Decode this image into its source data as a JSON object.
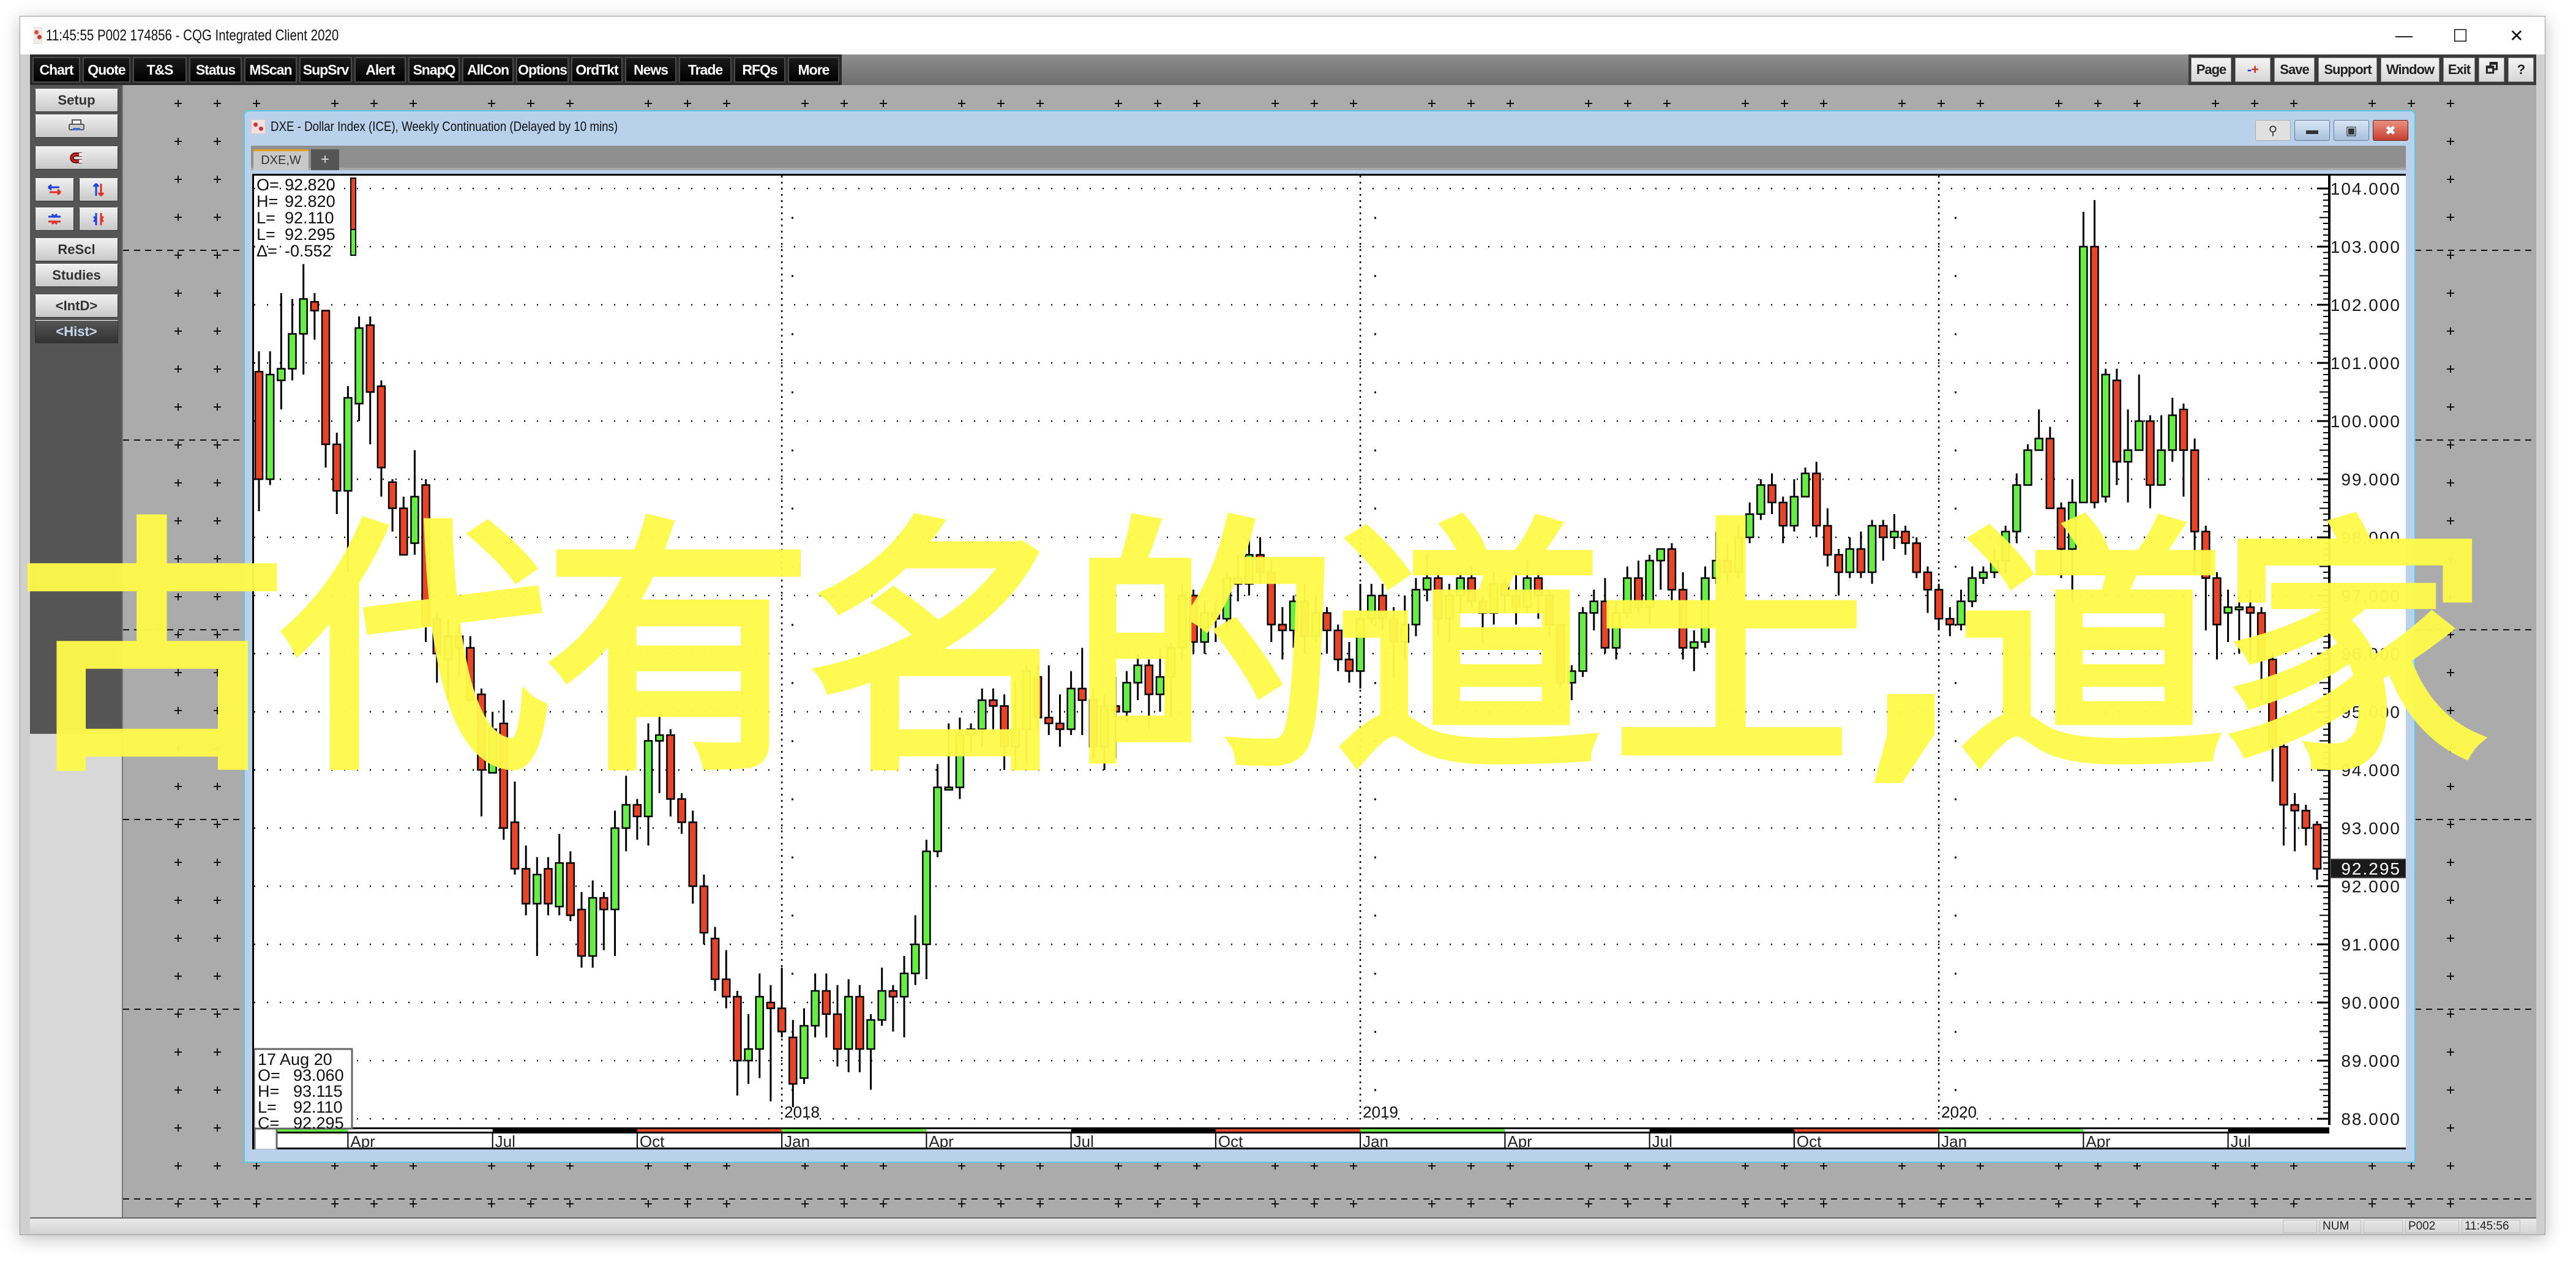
{
  "app": {
    "title": "11:45:55   P002   174856 - CQG Integrated Client 2020",
    "window_controls": {
      "minimize": "—",
      "maximize": "☐",
      "close": "✕"
    }
  },
  "toolbar": {
    "left_buttons": [
      "Chart",
      "Quote",
      "T&S",
      "Status",
      "MScan",
      "SupSrv",
      "Alert",
      "SnapQ",
      "AllCon",
      "Options",
      "OrdTkt",
      "News",
      "Trade",
      "RFQs",
      "More"
    ],
    "right_buttons": [
      "Page",
      "-+",
      "Save",
      "Support",
      "Window",
      "Exit",
      "🗗",
      "?"
    ]
  },
  "sidebar": {
    "setup": "Setup",
    "print_icon": "printer-icon",
    "magnet_icon": "magnet-icon",
    "rescl": "ReScl",
    "studies": "Studies",
    "intd": "<IntD>",
    "hist": "<Hist>"
  },
  "chart_window": {
    "title": "DXE - Dollar Index (ICE), Weekly Continuation (Delayed by 10 mins)",
    "tab_label": "DXE,W",
    "tab_add": "+",
    "controls": {
      "pin": "⚲",
      "minimize": "▬",
      "restore": "▣",
      "close": "✖"
    }
  },
  "top_readout": [
    {
      "label": "O=",
      "value": "92.820"
    },
    {
      "label": "H=",
      "value": "92.820"
    },
    {
      "label": "L=",
      "value": "92.110"
    },
    {
      "label": "L=",
      "value": "92.295"
    },
    {
      "label": "Δ=",
      "value": "-0.552"
    }
  ],
  "cursor_readout": {
    "date": "17 Aug 20",
    "rows": [
      {
        "label": "O=",
        "value": "93.060"
      },
      {
        "label": "H=",
        "value": "93.115"
      },
      {
        "label": "L=",
        "value": "92.110"
      },
      {
        "label": "C=",
        "value": "92.295"
      }
    ]
  },
  "last_price_tag": "92.295",
  "status_bar": {
    "num": "NUM",
    "page": "P002",
    "time": "11:45:56"
  },
  "overlay_text": "古代有名的道士,道家",
  "colors": {
    "up": "#66ee44",
    "down": "#e84428",
    "overlay": "#fefa4a",
    "toolbar": "#000000"
  },
  "chart_data": {
    "type": "candlestick",
    "title": "DXE - Dollar Index (ICE), Weekly Continuation",
    "xlabel": "",
    "ylabel": "",
    "ylim": [
      87.6,
      104.3
    ],
    "y_ticks": [
      "104.000",
      "103.000",
      "102.000",
      "101.000",
      "100.000",
      "99.000",
      "98.000",
      "97.000",
      "96.000",
      "95.000",
      "94.000",
      "93.000",
      "92.000",
      "91.000",
      "90.000",
      "89.000",
      "88.000"
    ],
    "x_ticks": [
      {
        "label": "Apr",
        "week": 8
      },
      {
        "label": "Jul",
        "week": 21
      },
      {
        "label": "Oct",
        "week": 34
      },
      {
        "label": "Jan",
        "week": 47,
        "year": "2018"
      },
      {
        "label": "Apr",
        "week": 60
      },
      {
        "label": "Jul",
        "week": 73
      },
      {
        "label": "Oct",
        "week": 86
      },
      {
        "label": "Jan",
        "week": 99,
        "year": "2019"
      },
      {
        "label": "Apr",
        "week": 112
      },
      {
        "label": "Jul",
        "week": 125
      },
      {
        "label": "Oct",
        "week": 138
      },
      {
        "label": "Jan",
        "week": 151,
        "year": "2020"
      },
      {
        "label": "Apr",
        "week": 164
      },
      {
        "label": "Jul",
        "week": 177
      }
    ],
    "grid": true,
    "candles": [
      [
        100.85,
        99.0,
        101.2,
        98.45
      ],
      [
        99.0,
        100.8,
        101.2,
        98.9
      ],
      [
        100.7,
        100.9,
        102.2,
        100.2
      ],
      [
        100.9,
        101.5,
        102.1,
        100.7
      ],
      [
        101.5,
        102.1,
        102.7,
        100.8
      ],
      [
        102.05,
        101.9,
        102.2,
        101.4
      ],
      [
        101.9,
        99.6,
        101.6,
        99.2
      ],
      [
        99.6,
        98.8,
        99.8,
        98.4
      ],
      [
        98.8,
        100.4,
        100.6,
        97.4
      ],
      [
        100.3,
        101.6,
        101.8,
        100.0
      ],
      [
        101.65,
        100.5,
        101.8,
        99.6
      ],
      [
        100.6,
        99.2,
        100.7,
        98.7
      ],
      [
        98.95,
        98.5,
        99.0,
        98.1
      ],
      [
        98.5,
        97.7,
        98.7,
        97.7
      ],
      [
        97.9,
        98.7,
        99.5,
        97.7
      ],
      [
        98.9,
        96.5,
        99.0,
        96.2
      ],
      [
        96.6,
        96.0,
        96.7,
        95.5
      ],
      [
        95.9,
        96.3,
        96.6,
        95.2
      ],
      [
        96.3,
        96.1,
        96.5,
        95.6
      ],
      [
        96.1,
        95.2,
        96.3,
        95.2
      ],
      [
        95.3,
        94.0,
        95.4,
        93.2
      ],
      [
        93.95,
        94.7,
        95.0,
        94.0
      ],
      [
        94.8,
        93.0,
        95.2,
        92.8
      ],
      [
        93.1,
        92.3,
        93.8,
        92.2
      ],
      [
        92.3,
        91.7,
        92.7,
        91.5
      ],
      [
        91.7,
        92.2,
        92.5,
        90.8
      ],
      [
        92.3,
        91.7,
        92.5,
        91.5
      ],
      [
        91.65,
        92.4,
        92.9,
        91.5
      ],
      [
        92.4,
        91.5,
        92.6,
        91.4
      ],
      [
        91.6,
        90.8,
        91.9,
        90.6
      ],
      [
        90.8,
        91.8,
        92.1,
        90.6
      ],
      [
        91.8,
        91.6,
        91.9,
        90.9
      ],
      [
        91.6,
        93.0,
        93.3,
        90.8
      ],
      [
        93.0,
        93.4,
        93.9,
        92.6
      ],
      [
        93.4,
        93.2,
        93.5,
        92.8
      ],
      [
        93.2,
        94.5,
        94.8,
        92.7
      ],
      [
        94.5,
        94.6,
        95.0,
        93.6
      ],
      [
        94.6,
        93.5,
        94.7,
        93.2
      ],
      [
        93.5,
        93.1,
        93.6,
        92.9
      ],
      [
        93.1,
        92.0,
        93.3,
        91.7
      ],
      [
        92.0,
        91.2,
        92.2,
        91.0
      ],
      [
        91.1,
        90.4,
        91.3,
        90.2
      ],
      [
        90.4,
        90.1,
        90.9,
        89.9
      ],
      [
        90.1,
        89.0,
        90.2,
        88.4
      ],
      [
        89.0,
        89.2,
        89.8,
        88.6
      ],
      [
        89.2,
        90.1,
        90.5,
        88.7
      ],
      [
        90.0,
        89.9,
        90.3,
        88.3
      ],
      [
        89.9,
        89.5,
        90.6,
        89.4
      ],
      [
        89.4,
        88.6,
        89.7,
        88.2
      ],
      [
        88.7,
        89.6,
        89.9,
        88.6
      ],
      [
        89.6,
        90.2,
        90.5,
        89.4
      ],
      [
        90.2,
        89.8,
        90.5,
        89.4
      ],
      [
        89.8,
        89.2,
        90.3,
        88.9
      ],
      [
        89.2,
        90.1,
        90.4,
        88.8
      ],
      [
        90.1,
        89.2,
        90.3,
        88.8
      ],
      [
        89.2,
        89.7,
        89.8,
        88.5
      ],
      [
        89.7,
        90.2,
        90.6,
        89.6
      ],
      [
        90.2,
        90.1,
        90.3,
        89.5
      ],
      [
        90.1,
        90.5,
        90.8,
        89.4
      ],
      [
        90.5,
        91.0,
        91.5,
        90.3
      ],
      [
        91.0,
        92.6,
        92.8,
        90.4
      ],
      [
        92.6,
        93.7,
        94.1,
        92.5
      ],
      [
        93.7,
        93.7,
        94.8,
        93.7
      ],
      [
        93.7,
        94.6,
        94.9,
        93.5
      ],
      [
        94.6,
        94.7,
        94.8,
        94.3
      ],
      [
        94.7,
        95.2,
        95.4,
        94.4
      ],
      [
        95.2,
        95.1,
        95.4,
        94.7
      ],
      [
        95.1,
        94.4,
        95.3,
        94.0
      ],
      [
        94.4,
        94.7,
        95.5,
        94.0
      ],
      [
        94.7,
        95.7,
        95.8,
        94.1
      ],
      [
        95.6,
        94.9,
        95.8,
        94.7
      ],
      [
        94.9,
        94.8,
        95.8,
        94.6
      ],
      [
        94.8,
        94.7,
        95.3,
        94.4
      ],
      [
        94.7,
        95.4,
        95.7,
        94.6
      ],
      [
        95.4,
        95.2,
        96.1,
        94.6
      ],
      [
        95.2,
        94.4,
        95.4,
        94.2
      ],
      [
        94.4,
        95.1,
        95.3,
        94.0
      ],
      [
        95.1,
        95.0,
        95.6,
        94.2
      ],
      [
        95.0,
        95.5,
        95.7,
        94.8
      ],
      [
        95.5,
        95.8,
        96.0,
        95.2
      ],
      [
        95.8,
        95.3,
        95.9,
        94.7
      ],
      [
        95.3,
        95.6,
        96.1,
        95.0
      ],
      [
        95.6,
        96.1,
        96.2,
        94.9
      ],
      [
        96.1,
        97.0,
        97.2,
        95.9
      ],
      [
        97.0,
        96.2,
        97.1,
        96.0
      ],
      [
        96.2,
        96.7,
        96.9,
        96.0
      ],
      [
        96.7,
        96.6,
        96.9,
        96.2
      ],
      [
        96.6,
        97.3,
        97.4,
        96.4
      ],
      [
        97.3,
        97.2,
        97.7,
        96.9
      ],
      [
        97.2,
        97.7,
        98.0,
        97.0
      ],
      [
        97.7,
        97.4,
        98.0,
        97.2
      ],
      [
        97.4,
        96.5,
        97.6,
        96.2
      ],
      [
        96.5,
        96.4,
        96.8,
        95.9
      ],
      [
        96.4,
        96.9,
        97.0,
        96.1
      ],
      [
        96.9,
        96.3,
        97.2,
        96.0
      ],
      [
        96.3,
        96.7,
        97.0,
        96.2
      ],
      [
        96.7,
        96.4,
        96.8,
        96.0
      ],
      [
        96.4,
        95.9,
        96.5,
        95.7
      ],
      [
        95.9,
        95.7,
        96.2,
        95.5
      ],
      [
        95.7,
        96.6,
        97.2,
        95.4
      ],
      [
        96.6,
        97.0,
        97.2,
        96.5
      ],
      [
        97.0,
        96.6,
        97.2,
        96.4
      ],
      [
        96.6,
        96.2,
        96.8,
        95.6
      ],
      [
        96.2,
        96.5,
        97.0,
        95.9
      ],
      [
        96.5,
        97.1,
        97.3,
        96.3
      ],
      [
        97.1,
        97.3,
        97.7,
        96.9
      ],
      [
        97.3,
        96.6,
        97.4,
        96.3
      ],
      [
        96.6,
        97.0,
        97.2,
        96.2
      ],
      [
        97.0,
        97.3,
        97.4,
        96.7
      ],
      [
        97.3,
        96.9,
        97.5,
        96.8
      ],
      [
        96.9,
        96.7,
        97.0,
        96.2
      ],
      [
        96.7,
        97.2,
        97.4,
        96.5
      ],
      [
        97.2,
        97.0,
        97.3,
        96.7
      ],
      [
        97.0,
        96.8,
        97.4,
        96.5
      ],
      [
        96.8,
        97.3,
        97.6,
        96.7
      ],
      [
        97.3,
        97.0,
        97.4,
        96.6
      ],
      [
        97.0,
        96.5,
        97.1,
        96.3
      ],
      [
        96.5,
        95.5,
        96.5,
        95.4
      ],
      [
        95.5,
        95.7,
        95.8,
        95.2
      ],
      [
        95.7,
        96.7,
        96.8,
        95.6
      ],
      [
        96.7,
        96.9,
        97.1,
        96.4
      ],
      [
        96.9,
        96.1,
        97.3,
        96.0
      ],
      [
        96.1,
        96.7,
        96.9,
        95.9
      ],
      [
        96.7,
        97.3,
        97.5,
        96.6
      ],
      [
        97.3,
        96.8,
        97.6,
        96.7
      ],
      [
        96.8,
        97.6,
        97.7,
        96.5
      ],
      [
        97.6,
        97.8,
        97.8,
        97.1
      ],
      [
        97.8,
        97.1,
        97.9,
        96.9
      ],
      [
        97.1,
        96.1,
        97.4,
        95.9
      ],
      [
        96.1,
        96.2,
        96.4,
        95.7
      ],
      [
        96.2,
        97.3,
        97.5,
        96.1
      ],
      [
        97.3,
        97.6,
        98.1,
        97.2
      ],
      [
        97.6,
        97.4,
        97.9,
        97.2
      ],
      [
        97.4,
        98.0,
        98.2,
        97.3
      ],
      [
        98.0,
        98.4,
        98.6,
        97.9
      ],
      [
        98.4,
        98.9,
        99.0,
        98.3
      ],
      [
        98.9,
        98.6,
        99.1,
        98.4
      ],
      [
        98.6,
        98.2,
        98.7,
        97.9
      ],
      [
        98.2,
        98.7,
        99.0,
        98.1
      ],
      [
        98.7,
        99.1,
        99.2,
        98.7
      ],
      [
        99.1,
        98.2,
        99.3,
        98.0
      ],
      [
        98.2,
        97.7,
        98.5,
        97.5
      ],
      [
        97.7,
        97.4,
        97.8,
        97.0
      ],
      [
        97.4,
        97.8,
        98.0,
        97.3
      ],
      [
        97.8,
        97.4,
        98.1,
        97.3
      ],
      [
        97.4,
        98.2,
        98.3,
        97.2
      ],
      [
        98.2,
        98.0,
        98.3,
        97.6
      ],
      [
        98.0,
        98.1,
        98.4,
        97.8
      ],
      [
        98.1,
        97.9,
        98.2,
        97.7
      ],
      [
        97.9,
        97.4,
        98.0,
        97.3
      ],
      [
        97.4,
        97.1,
        97.5,
        96.7
      ],
      [
        97.1,
        96.6,
        97.2,
        96.4
      ],
      [
        96.6,
        96.5,
        96.8,
        96.3
      ],
      [
        96.5,
        96.9,
        97.1,
        96.4
      ],
      [
        96.9,
        97.3,
        97.5,
        96.8
      ],
      [
        97.3,
        97.4,
        97.5,
        97.2
      ],
      [
        97.4,
        97.6,
        97.8,
        97.3
      ],
      [
        97.6,
        98.1,
        98.2,
        97.4
      ],
      [
        98.1,
        98.9,
        99.1,
        97.9
      ],
      [
        98.9,
        99.5,
        99.6,
        98.9
      ],
      [
        99.5,
        99.7,
        100.2,
        99.6
      ],
      [
        99.7,
        98.5,
        99.9,
        98.5
      ],
      [
        98.5,
        97.8,
        98.6,
        97.3
      ],
      [
        97.8,
        98.6,
        99.0,
        96.9
      ],
      [
        98.6,
        103.0,
        103.6,
        98.6
      ],
      [
        103.0,
        98.6,
        103.8,
        98.5
      ],
      [
        98.7,
        100.8,
        100.9,
        98.6
      ],
      [
        100.7,
        99.3,
        100.9,
        98.9
      ],
      [
        99.3,
        99.5,
        100.2,
        98.6
      ],
      [
        99.5,
        100.0,
        100.8,
        99.6
      ],
      [
        100.0,
        98.9,
        100.1,
        98.5
      ],
      [
        98.9,
        99.5,
        100.1,
        99.2
      ],
      [
        99.5,
        100.1,
        100.4,
        99.3
      ],
      [
        100.2,
        99.5,
        100.3,
        98.7
      ],
      [
        99.5,
        98.1,
        99.7,
        97.4
      ],
      [
        98.1,
        97.3,
        98.2,
        96.4
      ],
      [
        97.3,
        96.5,
        97.4,
        95.9
      ],
      [
        96.7,
        96.8,
        97.1,
        96.2
      ],
      [
        96.8,
        96.8,
        97.0,
        96.0
      ],
      [
        96.8,
        96.7,
        97.1,
        95.9
      ],
      [
        96.7,
        95.9,
        96.8,
        95.2
      ],
      [
        95.9,
        94.4,
        96.0,
        93.8
      ],
      [
        94.4,
        93.4,
        94.5,
        92.7
      ],
      [
        93.4,
        93.3,
        93.6,
        92.6
      ],
      [
        93.3,
        93.0,
        93.4,
        92.7
      ],
      [
        93.06,
        92.3,
        93.12,
        92.11
      ]
    ]
  }
}
